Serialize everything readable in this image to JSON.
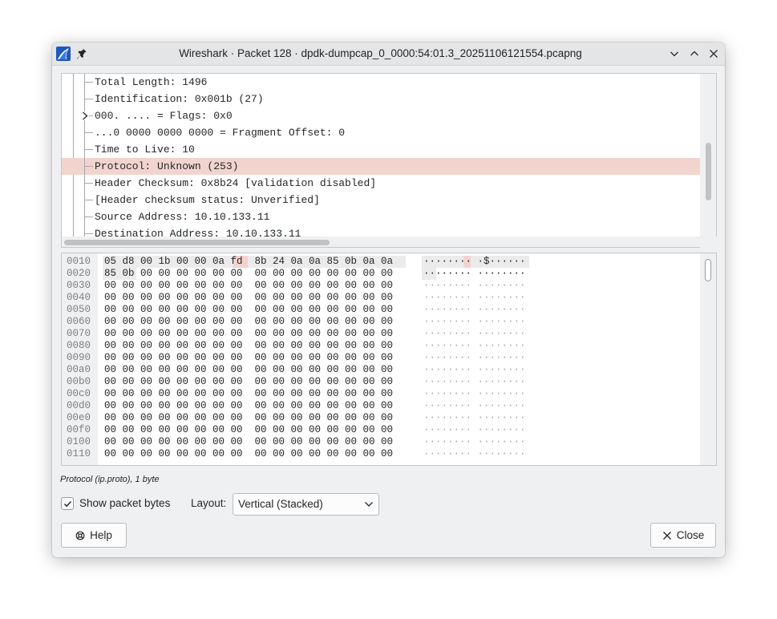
{
  "window": {
    "title": "Wireshark · Packet 128 · dpdk-dumpcap_0_0000:54:01.3_20251106121554.pcapng"
  },
  "tree": {
    "rows": [
      {
        "text": "Total Length: 1496",
        "expandable": false,
        "selected": false
      },
      {
        "text": "Identification: 0x001b (27)",
        "expandable": false,
        "selected": false
      },
      {
        "text": "000. .... = Flags: 0x0",
        "expandable": true,
        "selected": false
      },
      {
        "text": "...0 0000 0000 0000 = Fragment Offset: 0",
        "expandable": false,
        "selected": false
      },
      {
        "text": "Time to Live: 10",
        "expandable": false,
        "selected": false
      },
      {
        "text": "Protocol: Unknown (253)",
        "expandable": false,
        "selected": true
      },
      {
        "text": "Header Checksum: 0x8b24 [validation disabled]",
        "expandable": false,
        "selected": false
      },
      {
        "text": "[Header checksum status: Unverified]",
        "expandable": false,
        "selected": false
      },
      {
        "text": "Source Address: 10.10.133.11",
        "expandable": false,
        "selected": false
      },
      {
        "text": "Destination Address: 10.10.133.11",
        "expandable": false,
        "selected": false
      }
    ]
  },
  "bytes": {
    "rows": [
      {
        "offset": "0010",
        "hex": "05 d8 00 1b 00 00 0a fd  8b 24 0a 0a 85 0b 0a 0a",
        "ascii": "········ ·$······"
      },
      {
        "offset": "0020",
        "hex": "85 0b 00 00 00 00 00 00  00 00 00 00 00 00 00 00",
        "ascii": "········ ········"
      },
      {
        "offset": "0030",
        "hex": "00 00 00 00 00 00 00 00  00 00 00 00 00 00 00 00",
        "ascii": "········ ········"
      },
      {
        "offset": "0040",
        "hex": "00 00 00 00 00 00 00 00  00 00 00 00 00 00 00 00",
        "ascii": "········ ········"
      },
      {
        "offset": "0050",
        "hex": "00 00 00 00 00 00 00 00  00 00 00 00 00 00 00 00",
        "ascii": "········ ········"
      },
      {
        "offset": "0060",
        "hex": "00 00 00 00 00 00 00 00  00 00 00 00 00 00 00 00",
        "ascii": "········ ········"
      },
      {
        "offset": "0070",
        "hex": "00 00 00 00 00 00 00 00  00 00 00 00 00 00 00 00",
        "ascii": "········ ········"
      },
      {
        "offset": "0080",
        "hex": "00 00 00 00 00 00 00 00  00 00 00 00 00 00 00 00",
        "ascii": "········ ········"
      },
      {
        "offset": "0090",
        "hex": "00 00 00 00 00 00 00 00  00 00 00 00 00 00 00 00",
        "ascii": "········ ········"
      },
      {
        "offset": "00a0",
        "hex": "00 00 00 00 00 00 00 00  00 00 00 00 00 00 00 00",
        "ascii": "········ ········"
      },
      {
        "offset": "00b0",
        "hex": "00 00 00 00 00 00 00 00  00 00 00 00 00 00 00 00",
        "ascii": "········ ········"
      },
      {
        "offset": "00c0",
        "hex": "00 00 00 00 00 00 00 00  00 00 00 00 00 00 00 00",
        "ascii": "········ ········"
      },
      {
        "offset": "00d0",
        "hex": "00 00 00 00 00 00 00 00  00 00 00 00 00 00 00 00",
        "ascii": "········ ········"
      },
      {
        "offset": "00e0",
        "hex": "00 00 00 00 00 00 00 00  00 00 00 00 00 00 00 00",
        "ascii": "········ ········"
      },
      {
        "offset": "00f0",
        "hex": "00 00 00 00 00 00 00 00  00 00 00 00 00 00 00 00",
        "ascii": "········ ········"
      },
      {
        "offset": "0100",
        "hex": "00 00 00 00 00 00 00 00  00 00 00 00 00 00 00 00",
        "ascii": "········ ········"
      },
      {
        "offset": "0110",
        "hex": "00 00 00 00 00 00 00 00  00 00 00 00 00 00 00 00",
        "ascii": "········ ········"
      }
    ]
  },
  "status_text": "Protocol (ip.proto), 1 byte",
  "controls": {
    "show_bytes_label": "Show packet bytes",
    "show_bytes_checked": true,
    "layout_label": "Layout:",
    "layout_value": "Vertical (Stacked)"
  },
  "buttons": {
    "help_label": "Help",
    "close_label": "Close"
  },
  "colors": {
    "selection": "#f2d4cf",
    "background": "#eff0f1",
    "text": "#232629"
  }
}
